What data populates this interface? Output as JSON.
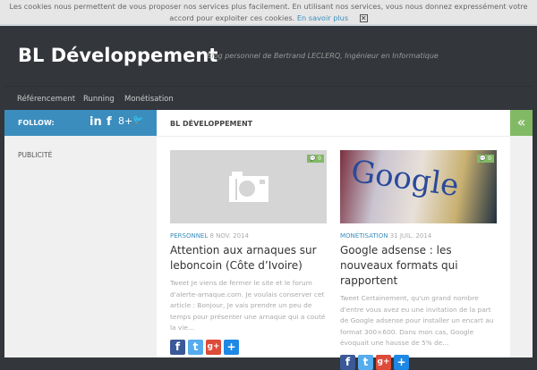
{
  "cookie": {
    "text": "Les cookies nous permettent de vous proposer nos services plus facilement. En utilisant nos services, vous nous donnez expressément votre accord pour exploiter ces cookies.",
    "link": "En savoir plus",
    "close": "✕"
  },
  "header": {
    "title": "BL Développement",
    "tagline": "Blog personnel de Bertrand LECLERQ, Ingénieur en Informatique"
  },
  "nav": [
    "Référencement",
    "Running",
    "Monétisation"
  ],
  "sidebar": {
    "follow": "FOLLOW:",
    "social": [
      "in",
      "f",
      "8+",
      "🐦"
    ],
    "widget": "PUBLICITÉ"
  },
  "main": {
    "heading": "BL DÉVELOPPEMENT",
    "toggle": "«",
    "posts": [
      {
        "comments": "0",
        "category": "PERSONNEL",
        "date": "8 NOV. 2014",
        "title": "Attention aux arnaques sur leboncoin (Côte d’Ivoire)",
        "excerpt": "Tweet Je viens de fermer le site et le forum d'alerte-arnaque.com. Je voulais conserver cet article : Bonjour, Je vais prendre un peu de temps pour présenter une arnaque qui a couté la vie..."
      },
      {
        "comments": "0",
        "category": "MONÉTISATION",
        "date": "31 JUIL. 2014",
        "title": "Google adsense : les nouveaux formats qui rapportent",
        "excerpt": "Tweet Certainement, qu'un grand nombre d'entre vous avez eu une invitation de la part de Google adsense pour installer un encart au format 300×600. Dans mon cas, Google évoquait une hausse de 5% de...",
        "image_text": "Google"
      }
    ]
  },
  "share": [
    "f",
    "t",
    "g+",
    "+"
  ]
}
